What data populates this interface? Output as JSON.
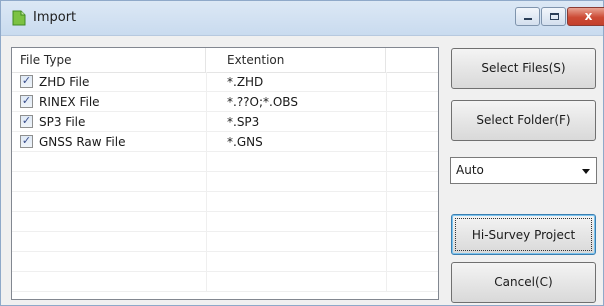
{
  "window": {
    "title": "Import",
    "close_glyph": "x",
    "app_icon": "green-document-icon"
  },
  "file_list": {
    "columns": [
      "File Type",
      "Extention",
      ""
    ],
    "rows": [
      {
        "name": "ZHD File",
        "ext": "*.ZHD",
        "checked": true
      },
      {
        "name": "RINEX File",
        "ext": "*.??O;*.OBS",
        "checked": true
      },
      {
        "name": "SP3 File",
        "ext": "*.SP3",
        "checked": true
      },
      {
        "name": "GNSS Raw File",
        "ext": "*.GNS",
        "checked": true
      }
    ],
    "check_glyph": "✓"
  },
  "buttons": {
    "select_files": "Select Files(S)",
    "select_folder": "Select Folder(F)",
    "hi_survey": "Hi-Survey Project",
    "cancel": "Cancel(C)"
  },
  "mode_select": {
    "value": "Auto"
  },
  "colors": {
    "titlebar": "#c9dbef",
    "close_button": "#cc4b35",
    "default_button_border": "#3c7fb1",
    "checkmark": "#3a4e8c"
  }
}
